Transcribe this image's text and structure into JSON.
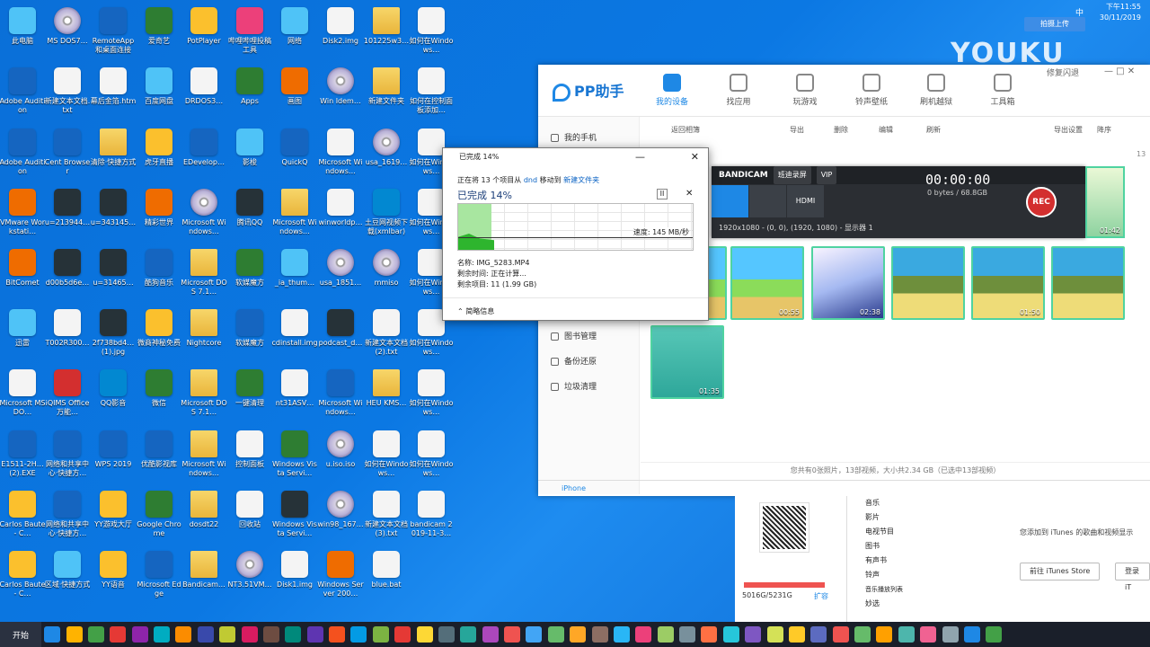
{
  "desktop": {
    "icons": [
      {
        "label": "此电脑",
        "kind": "sky",
        "icon": "computer-icon"
      },
      {
        "label": "MS DOS7…",
        "kind": "disc",
        "icon": "disc-icon"
      },
      {
        "label": "RemoteApp和桌面连接",
        "kind": "blue",
        "icon": "remote-icon"
      },
      {
        "label": "爱奇艺",
        "kind": "green",
        "icon": "iqiyi-icon"
      },
      {
        "label": "PotPlayer",
        "kind": "yellow",
        "icon": "play-icon"
      },
      {
        "label": "哔哩哔哩投稿工具",
        "kind": "pink",
        "icon": "bilibili-icon"
      },
      {
        "label": "网络",
        "kind": "sky",
        "icon": "network-icon"
      },
      {
        "label": "Disk2.img",
        "kind": "file",
        "icon": "file-icon"
      },
      {
        "label": "101225w3…",
        "kind": "folder",
        "icon": "image-icon"
      },
      {
        "label": "如何在Windows…",
        "kind": "file",
        "icon": "document-icon"
      },
      {
        "label": "Adobe Audition",
        "kind": "blue",
        "icon": "adobe-icon"
      },
      {
        "label": "新建文本文档.txt",
        "kind": "file",
        "icon": "file-icon"
      },
      {
        "label": "幕后金箔.htm",
        "kind": "file",
        "icon": "html-icon"
      },
      {
        "label": "百度网盘",
        "kind": "sky",
        "icon": "cloud-icon"
      },
      {
        "label": "DRDOS3…",
        "kind": "file",
        "icon": "file-icon"
      },
      {
        "label": "Apps",
        "kind": "green",
        "icon": "apps-icon"
      },
      {
        "label": "画图",
        "kind": "orange",
        "icon": "paint-icon"
      },
      {
        "label": "Win Idem…",
        "kind": "disc",
        "icon": "disc-icon"
      },
      {
        "label": "新建文件夹",
        "kind": "folder",
        "icon": "folder-icon"
      },
      {
        "label": "如何在控制面板添加…",
        "kind": "file",
        "icon": "document-icon"
      },
      {
        "label": "Adobe Audition",
        "kind": "blue",
        "icon": "adobe-icon"
      },
      {
        "label": "Cent Browser",
        "kind": "blue",
        "icon": "browser-icon"
      },
      {
        "label": "清除·快捷方式",
        "kind": "folder",
        "icon": "folder-icon"
      },
      {
        "label": "虎牙直播",
        "kind": "yellow",
        "icon": "huya-icon"
      },
      {
        "label": "EDevelop…",
        "kind": "blue",
        "icon": "ie-icon"
      },
      {
        "label": "影梭",
        "kind": "sky",
        "icon": "bird-icon"
      },
      {
        "label": "QuickQ",
        "kind": "blue",
        "icon": "quickq-icon"
      },
      {
        "label": "Microsoft Windows…",
        "kind": "file",
        "icon": "file-icon"
      },
      {
        "label": "usa_1619…",
        "kind": "disc",
        "icon": "disc-icon"
      },
      {
        "label": "如何在Windows…",
        "kind": "file",
        "icon": "document-icon"
      },
      {
        "label": "VMware Workstati…",
        "kind": "orange",
        "icon": "vmware-icon"
      },
      {
        "label": "u=213944…",
        "kind": "dark",
        "icon": "image-icon"
      },
      {
        "label": "u=343145…",
        "kind": "dark",
        "icon": "image-icon"
      },
      {
        "label": "精彩世界",
        "kind": "orange",
        "icon": "speaker-icon"
      },
      {
        "label": "Microsoft Windows…",
        "kind": "disc",
        "icon": "disc-icon"
      },
      {
        "label": "腾讯QQ",
        "kind": "dark",
        "icon": "qq-icon"
      },
      {
        "label": "Microsoft Windows…",
        "kind": "folder",
        "icon": "folder-icon"
      },
      {
        "label": "winworldp…",
        "kind": "file",
        "icon": "file-icon"
      },
      {
        "label": "土豆网视频下载(xmlbar)",
        "kind": "cyan",
        "icon": "download-icon"
      },
      {
        "label": "如何在Windows…",
        "kind": "file",
        "icon": "document-icon"
      },
      {
        "label": "BitComet",
        "kind": "orange",
        "icon": "bitcomet-icon"
      },
      {
        "label": "d00b5d6e…",
        "kind": "dark",
        "icon": "image-icon"
      },
      {
        "label": "u=31465…",
        "kind": "dark",
        "icon": "image-icon"
      },
      {
        "label": "酷狗音乐",
        "kind": "blue",
        "icon": "kugou-icon"
      },
      {
        "label": "Microsoft DOS 7.1…",
        "kind": "folder",
        "icon": "folder-icon"
      },
      {
        "label": "软媒魔方",
        "kind": "green",
        "icon": "cube-icon"
      },
      {
        "label": "_ia_thum…",
        "kind": "sky",
        "icon": "image-icon"
      },
      {
        "label": "usa_1851…",
        "kind": "disc",
        "icon": "disc-icon"
      },
      {
        "label": "mmiso",
        "kind": "disc",
        "icon": "disc-icon"
      },
      {
        "label": "如何在Windows…",
        "kind": "file",
        "icon": "document-icon"
      },
      {
        "label": "迅雷",
        "kind": "sky",
        "icon": "thunder-icon"
      },
      {
        "label": "T002R300…",
        "kind": "file",
        "icon": "image-icon"
      },
      {
        "label": "2f738bd4…(1).jpg",
        "kind": "dark",
        "icon": "image-icon"
      },
      {
        "label": "微商神秘免费",
        "kind": "yellow",
        "icon": "glasses-icon"
      },
      {
        "label": "Nightcore",
        "kind": "folder",
        "icon": "folder-icon"
      },
      {
        "label": "软媒魔方",
        "kind": "blue",
        "icon": "windows-icon"
      },
      {
        "label": "cdinstall.img",
        "kind": "file",
        "icon": "file-icon"
      },
      {
        "label": "podcast_d…",
        "kind": "dark",
        "icon": "image-icon"
      },
      {
        "label": "新建文本文档(2).txt",
        "kind": "file",
        "icon": "file-icon"
      },
      {
        "label": "如何在Windows…",
        "kind": "file",
        "icon": "document-icon"
      },
      {
        "label": "Microsoft MS DO…",
        "kind": "file",
        "icon": "file-icon"
      },
      {
        "label": "iQIMS Office万能…",
        "kind": "red",
        "icon": "office-icon"
      },
      {
        "label": "QQ影音",
        "kind": "cyan",
        "icon": "qqplayer-icon"
      },
      {
        "label": "微信",
        "kind": "green",
        "icon": "wechat-icon"
      },
      {
        "label": "Microsoft DOS 7.1…",
        "kind": "folder",
        "icon": "folder-icon"
      },
      {
        "label": "一键清理",
        "kind": "green",
        "icon": "clean-icon"
      },
      {
        "label": "nt31ASV…",
        "kind": "file",
        "icon": "file-icon"
      },
      {
        "label": "Microsoft Windows…",
        "kind": "blue",
        "icon": "image-icon"
      },
      {
        "label": "HEU KMS…",
        "kind": "folder",
        "icon": "folder-icon"
      },
      {
        "label": "如何在Windows…",
        "kind": "file",
        "icon": "document-icon"
      },
      {
        "label": "E1511-2H…(2).EXE",
        "kind": "blue",
        "icon": "exe-icon"
      },
      {
        "label": "网络和共享中心·快捷方…",
        "kind": "blue",
        "icon": "network-icon"
      },
      {
        "label": "WPS 2019",
        "kind": "blue",
        "icon": "wps-icon"
      },
      {
        "label": "优酷影视库",
        "kind": "blue",
        "icon": "youku-icon"
      },
      {
        "label": "Microsoft Windows…",
        "kind": "folder",
        "icon": "folder-icon"
      },
      {
        "label": "控制面板",
        "kind": "file",
        "icon": "control-panel-icon"
      },
      {
        "label": "Windows Vista Servi…",
        "kind": "green",
        "icon": "image-icon"
      },
      {
        "label": "u.iso.iso",
        "kind": "disc",
        "icon": "disc-icon"
      },
      {
        "label": "如何在Windows…",
        "kind": "file",
        "icon": "document-icon"
      },
      {
        "label": "如何在Windows…",
        "kind": "file",
        "icon": "document-icon"
      },
      {
        "label": "Carlos Baute - C…",
        "kind": "yellow",
        "icon": "music-icon"
      },
      {
        "label": "网络和共享中心·快捷方…",
        "kind": "blue",
        "icon": "network-icon"
      },
      {
        "label": "YY游戏大厅",
        "kind": "yellow",
        "icon": "yy-icon"
      },
      {
        "label": "Google Chrome",
        "kind": "green",
        "icon": "chrome-icon"
      },
      {
        "label": "dosdt22",
        "kind": "folder",
        "icon": "folder-icon"
      },
      {
        "label": "回收站",
        "kind": "file",
        "icon": "recycle-bin-icon"
      },
      {
        "label": "Windows Vista Servi…",
        "kind": "dark",
        "icon": "image-icon"
      },
      {
        "label": "win98_167…",
        "kind": "disc",
        "icon": "disc-icon"
      },
      {
        "label": "新建文本文档(3).txt",
        "kind": "file",
        "icon": "file-icon"
      },
      {
        "label": "bandicam 2019-11-3…",
        "kind": "file",
        "icon": "video-icon"
      },
      {
        "label": "Carlos Baute - C…",
        "kind": "yellow",
        "icon": "music-icon"
      },
      {
        "label": "区域·快捷方式",
        "kind": "sky",
        "icon": "globe-icon"
      },
      {
        "label": "YY语音",
        "kind": "yellow",
        "icon": "yy-icon"
      },
      {
        "label": "Microsoft Edge",
        "kind": "blue",
        "icon": "edge-icon"
      },
      {
        "label": "Bandicam…",
        "kind": "folder",
        "icon": "folder-icon"
      },
      {
        "label": "NT3.51VM…",
        "kind": "disc",
        "icon": "disc-icon"
      },
      {
        "label": "Disk1.img",
        "kind": "file",
        "icon": "file-icon"
      },
      {
        "label": "Windows Server 200…",
        "kind": "orange",
        "icon": "disc-icon"
      },
      {
        "label": "blue.bat",
        "kind": "file",
        "icon": "bat-icon"
      }
    ]
  },
  "watermark": {
    "youku": "YOUKU",
    "share_label": "拍摄上传"
  },
  "pp": {
    "logo": "PP助手",
    "nav": [
      {
        "label": "我的设备",
        "active": true
      },
      {
        "label": "找应用"
      },
      {
        "label": "玩游戏"
      },
      {
        "label": "铃声壁纸"
      },
      {
        "label": "刷机越狱"
      },
      {
        "label": "工具箱"
      }
    ],
    "window_ctrl": "修复闪退",
    "sidebar": [
      {
        "label": "我的手机"
      },
      {
        "label": "图书管理"
      },
      {
        "label": "备份还原"
      },
      {
        "label": "垃圾清理"
      }
    ],
    "toolbar": [
      "返回相簿",
      "导出",
      "删除",
      "编辑",
      "刷新",
      "导出设置",
      "降序"
    ],
    "thumbs": [
      "00:55",
      "02:38",
      "01:50",
      "01:42",
      "01:35"
    ],
    "status": "您共有0张照片，13部视频，大小共2.34 GB（已选中13部视频）",
    "device": "iPhone",
    "top_count": "13"
  },
  "bandicam": {
    "title": "BANDICAM",
    "tag1": "班迪录屏",
    "tag2": "VIP",
    "time": "00:00:00",
    "size": "0 bytes / 68.8GB",
    "rec": "REC",
    "info": "1920x1080 - (0, 0), (1920, 1080) - 显示器 1",
    "mode_label": "HDMI",
    "thumb_time": "01:42"
  },
  "dialog": {
    "title": "已完成 14%",
    "line1_pre": "正在将 13 个项目从 ",
    "line1_src": "dnd",
    "line1_mid": " 移动到 ",
    "line1_dst": "新建文件夹",
    "big": "已完成 14%",
    "progress": 0.14,
    "speed": "速度: 145 MB/秒",
    "name": "名称: IMG_5283.MP4",
    "remaining_time": "剩余时间: 正在计算...",
    "remaining_items": "剩余项目: 11 (1.99 GB)",
    "more": "简略信息"
  },
  "itunes": {
    "list": [
      "音乐",
      "影片",
      "电视节目",
      "图书",
      "有声书",
      "铃声",
      "音乐播放列表",
      "妙选"
    ],
    "msg": "您添加到 iTunes 的歌曲和视频显示",
    "btn1": "前往 iTunes Store",
    "btn2": "登录 iT",
    "storage": "5016G/5231G",
    "expand": "扩容"
  },
  "taskbar": {
    "start": "开始",
    "ime": "中",
    "time": "下午11:55",
    "date": "30/11/2019"
  }
}
